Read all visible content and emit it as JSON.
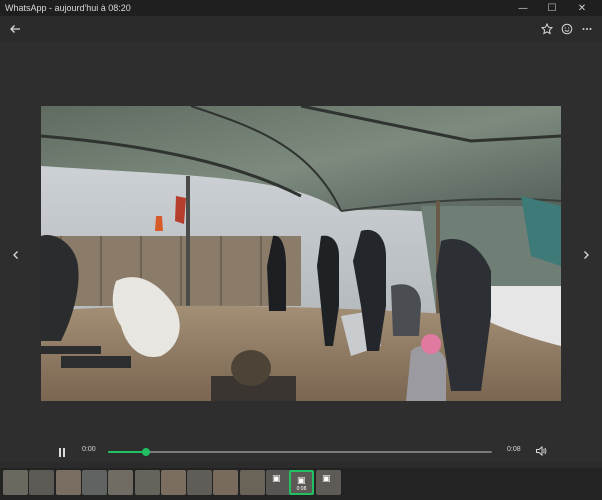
{
  "window": {
    "title": "WhatsApp - aujourd'hui à 08:20",
    "controls": {
      "minimize": "—",
      "maximize": "☐",
      "close": "✕"
    }
  },
  "toolbar": {
    "back_icon": "back-arrow-icon",
    "star_icon": "star-icon",
    "emoji_icon": "emoji-icon",
    "more_icon": "more-icon"
  },
  "viewer": {
    "prev_icon": "chevron-left-icon",
    "next_icon": "chevron-right-icon"
  },
  "player": {
    "current_time": "0:00",
    "duration": "0:08",
    "progress_fraction": 0.1,
    "accent_color": "#21c063"
  },
  "filmstrip": {
    "thumbs": [
      {
        "caption": ""
      },
      {
        "caption": ""
      },
      {
        "caption": ""
      },
      {
        "caption": ""
      },
      {
        "caption": ""
      },
      {
        "caption": ""
      },
      {
        "caption": ""
      },
      {
        "caption": ""
      },
      {
        "caption": ""
      },
      {
        "caption": ""
      },
      {
        "caption": ""
      },
      {
        "caption": "0:08",
        "selected": true
      },
      {
        "caption": ""
      }
    ]
  }
}
